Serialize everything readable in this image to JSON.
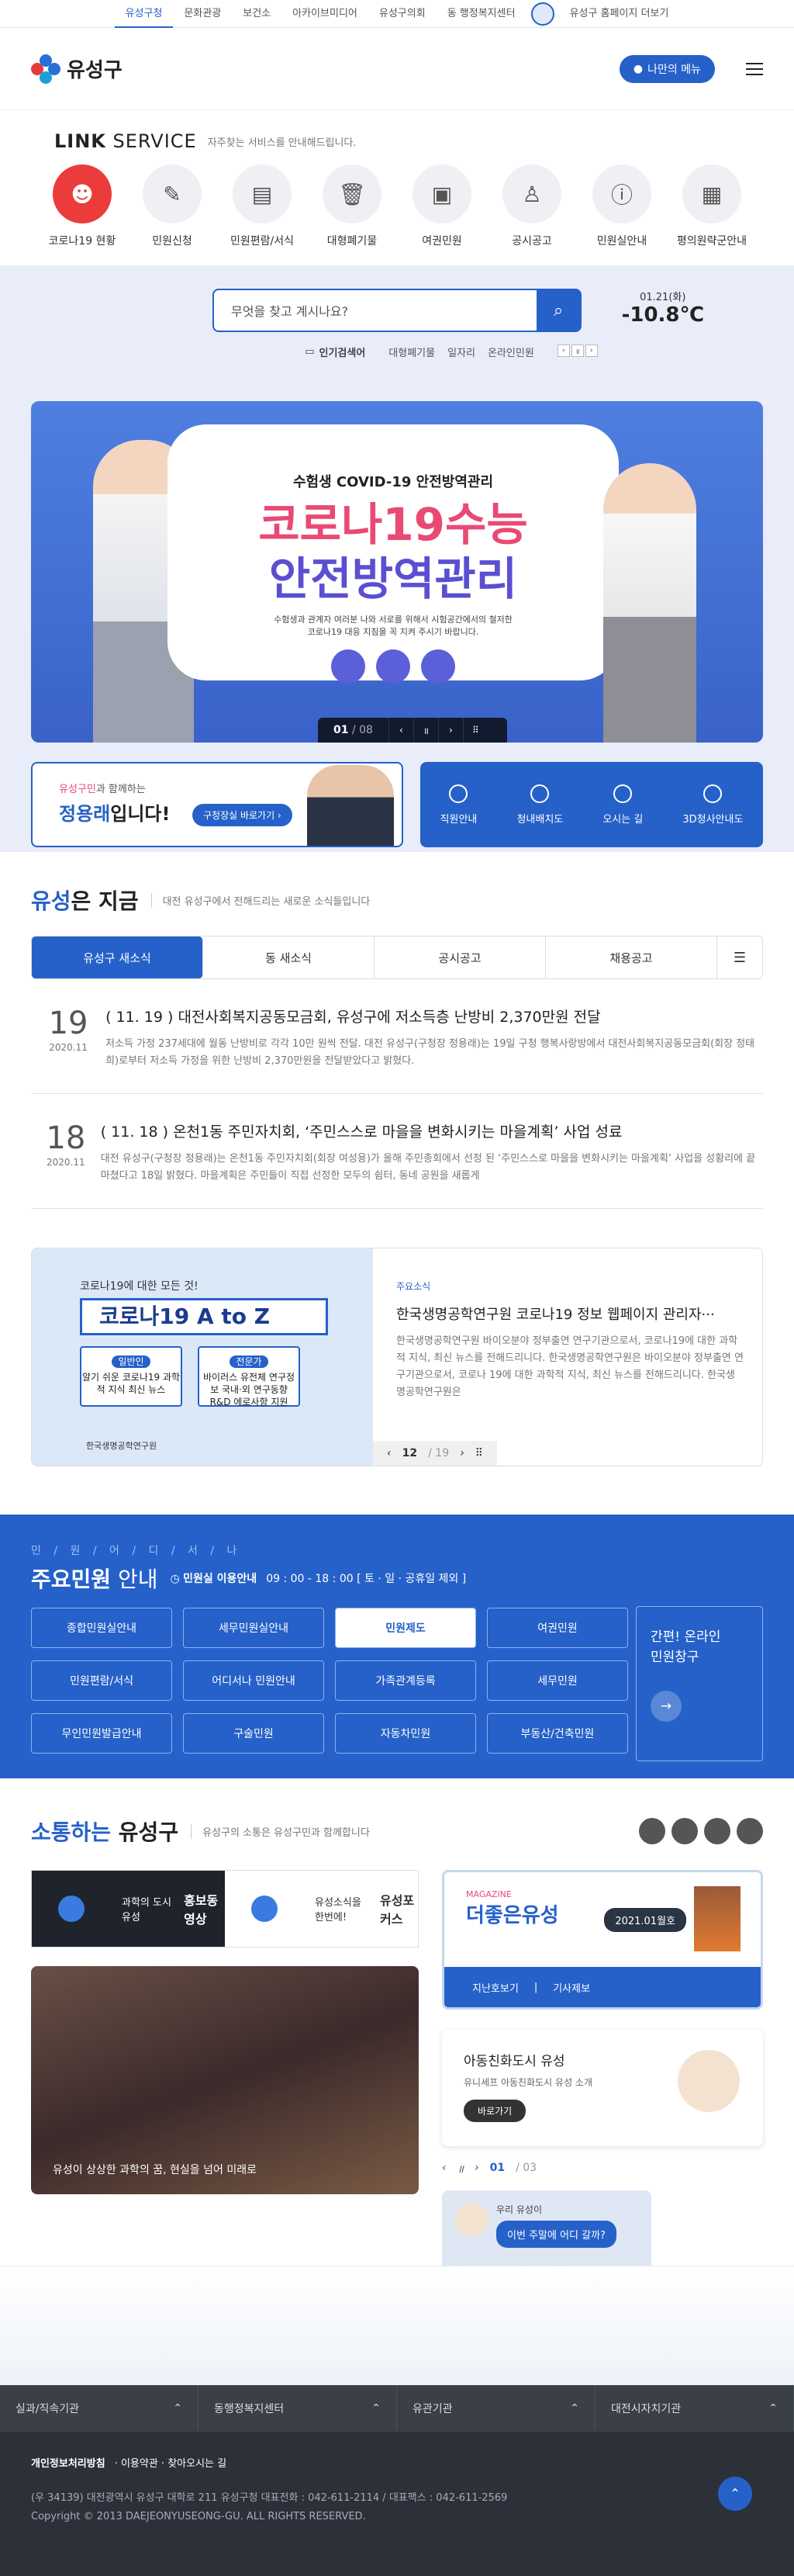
{
  "topnav": [
    "유성구청",
    "문화관광",
    "보건소",
    "아카이브미디어",
    "유성구의회",
    "동 행정복지센터",
    "유성구 홈페이지 더보기"
  ],
  "header": {
    "logo": "유성구",
    "menu_btn": "나만의 메뉴"
  },
  "link_service": {
    "title_bold": "LINK",
    "title_light": " SERVICE",
    "desc": "자주찾는 서비스를 안내해드립니다.",
    "items": [
      "코로나19 현황",
      "민원신청",
      "민원편람/서식",
      "대형폐기물",
      "여권민원",
      "공시공고",
      "민원실안내",
      "평의원략군안내"
    ]
  },
  "search": {
    "placeholder": "무엇을 찾고 계시나요?",
    "popular_label": "인기검색어",
    "keywords": [
      "대형폐기물",
      "일자리",
      "온라인민원"
    ]
  },
  "weather": {
    "date": "01.21(화)",
    "temp": "-10.8℃"
  },
  "banner": {
    "sub": "수험생 COVID-19 안전방역관리",
    "big1": "코로나19수능",
    "big2": "안전방역관리",
    "desc1": "수험생과 관계자 여러분 나와 서로를 위해서 시험공간에서의 철저한",
    "desc2": "코로나19 대응 지침을 꼭 지켜 주시기 바랍니다.",
    "current": "01",
    "total": "08"
  },
  "mayor": {
    "a1": "유성구민",
    "a2": "과 함께하는",
    "name1": "정용래",
    "name2": "입니다!",
    "btn": "구청장실 바로가기"
  },
  "quick": [
    "직원안내",
    "청내배치도",
    "오시는 길",
    "3D청사안내도"
  ],
  "news": {
    "title_blue": "유성",
    "title_rest": "은 지금",
    "desc": "대전 유성구에서 전해드리는 새로운 소식들입니다",
    "tabs": [
      "유성구 새소식",
      "동 새소식",
      "공시공고",
      "채용공고"
    ],
    "items": [
      {
        "day": "19",
        "ym": "2020.11",
        "title": "( 11. 19 ) 대전사회복지공동모금회, 유성구에 저소득층 난방비 2,370만원 전달",
        "text": "저소득 가정 237세대에 월동 난방비로 각각 10만 원씩 전달. 대전 유성구(구청장 정용래)는 19일 구청 행복사랑방에서 대전사회복지공동모금회(회장 정태희)로부터 저소득 가정을 위한 난방비 2,370만원을 전달받았다고 밝혔다."
      },
      {
        "day": "18",
        "ym": "2020.11",
        "title": "( 11. 18 ) 온천1동 주민자치회, ‘주민스스로 마을을 변화시키는 마을계획’ 사업 성료",
        "text": "대전 유성구(구청장 정용래)는 온천1동 주민자치회(회장 여성용)가 올해 주민총회에서 선정 된 ‘주민스스로 마을을 변화시키는 마을계획’ 사업을 성황리에 끝마쳤다고 18일 밝혔다. 마을계획은 주민들이 직접 선정한 모두의 쉼터, 동네 공원을 새롭게"
      }
    ]
  },
  "promo": {
    "cap": "코로나19에 대한 모든 것!",
    "az": "코로나19 A to Z",
    "box1_tag": "일반인",
    "box1_text": "알기 쉬운 코로나19 과학적 지식 최신 뉴스",
    "box2_tag": "전문가",
    "box2_text": "바이러스 유전체 연구정보 국내·외 연구동향 R&D 에로사항 지원",
    "org": "한국생명공학연구원",
    "cat": "주요소식",
    "title": "한국생명공학연구원 코로나19 정보 웹페이지 관리자···",
    "text": "한국생명공학연구원 바이오분야 정부출연 연구기관으로서, 코로나19에 대한 과학적 지식, 최신 뉴스를 전해드리니다. 한국생명공학연구원은 바이오분야 정부출연 연구기관으로서, 코로나 19에 대한 과학적 지식, 최신 뉴스를 전해드리니다. 한국생명공학연구원은",
    "current": "12",
    "total": "19"
  },
  "minwon": {
    "small": "민 / 원 / 어 / 디 / 서 / 나",
    "title_bold": "주요민원",
    "title_light": " 안내",
    "hours_label": "민원실 이용안내",
    "hours": "09 : 00 - 18 : 00 [ 토 · 일 · 공휴일 제외 ]",
    "items": [
      "종합민원실안내",
      "세무민원실안내",
      "민원제도",
      "여권민원",
      "민원편람/서식",
      "어디서나 민원안내",
      "가족관계등록",
      "세무민원",
      "무인민원발급안내",
      "구술민원",
      "자동차민원",
      "부동산/건축민원"
    ],
    "online1": "간편! 온라인",
    "online2": "민원창구"
  },
  "comm": {
    "title_blue": "소통하는",
    "title_rest": " 유성구",
    "desc": "유성구의 소통은 유성구민과 함께합니다",
    "tab1_small": "과학의 도시 유성",
    "tab1_big": "홍보동영상",
    "tab2_small": "유성소식을 한번에!",
    "tab2_big": "유성포커스",
    "photo_cap": "유성이 상상한 과학의 꿈, 현실을 넘어 미래로",
    "mag_small": "MAGAZINE",
    "mag_title": "더좋은유성",
    "mag_issue": "2021.01월호",
    "mag_links": [
      "지난호보기",
      "기사제보"
    ],
    "kids_title": "아동친화도시 유성",
    "kids_text": "유니세프 아동친화도시 유성 소개",
    "kids_btn": "바로가기",
    "pag_current": "01",
    "pag_total": "03",
    "walk_small": "우리 유성이",
    "walk_bubble": "이번 주말에 어디 갈까?"
  },
  "footer": {
    "menus": [
      "실과/직속기관",
      "동행정복지센터",
      "유관기관",
      "대전시자치기관"
    ],
    "links": [
      "개인정보처리방침",
      "이용약관",
      "찾아오시는 길"
    ],
    "addr": "(우 34139) 대전광역시 유성구 대학로 211    유성구청 대표전화 : 042-611-2114 / 대표팩스 : 042-611-2569",
    "copy": "Copyright © 2013 DAEJEONYUSEONG-GU. ALL RIGHTS RESERVED."
  }
}
